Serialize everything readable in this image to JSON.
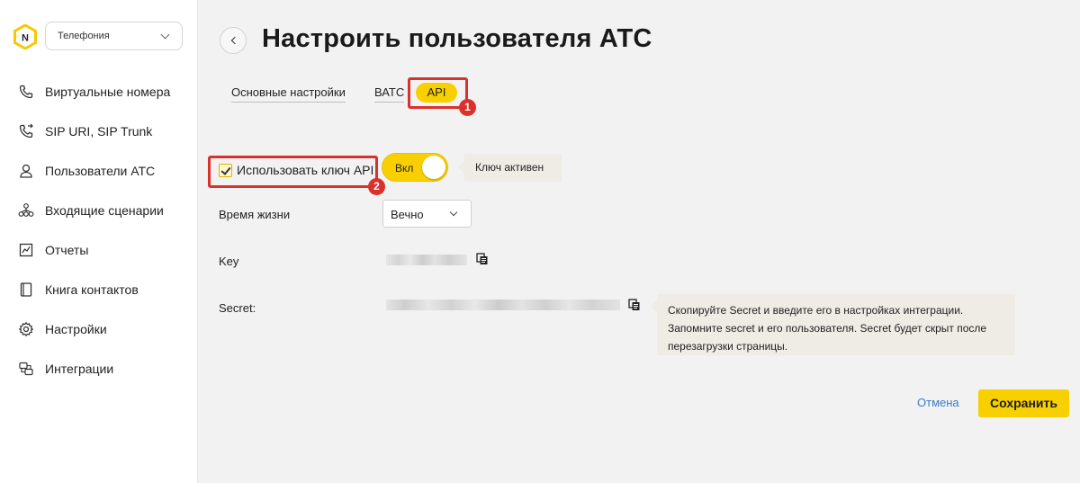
{
  "sidebar": {
    "product_select": "Телефония",
    "items": [
      {
        "label": "Виртуальные номера",
        "icon": "phone-icon"
      },
      {
        "label": "SIP URI, SIP Trunk",
        "icon": "phone-forward-icon"
      },
      {
        "label": "Пользователи АТС",
        "icon": "user-icon"
      },
      {
        "label": "Входящие сценарии",
        "icon": "scenario-icon"
      },
      {
        "label": "Отчеты",
        "icon": "chart-icon"
      },
      {
        "label": "Книга контактов",
        "icon": "book-icon"
      },
      {
        "label": "Настройки",
        "icon": "gear-icon"
      },
      {
        "label": "Интеграции",
        "icon": "integration-icon"
      }
    ]
  },
  "header": {
    "title": "Настроить пользователя АТС"
  },
  "tabs": [
    {
      "label": "Основные настройки",
      "active": false
    },
    {
      "label": "ВАТС",
      "active": false
    },
    {
      "label": "API",
      "active": true
    }
  ],
  "annotations": {
    "marker_1": "1",
    "marker_2": "2",
    "color": "#d9312b"
  },
  "api": {
    "use_key_label": "Использовать ключ API",
    "use_key_checked": true,
    "toggle_label": "Вкл",
    "toggle_on": true,
    "key_status_hint": "Ключ активен",
    "lifetime_label": "Время жизни",
    "lifetime_value": "Вечно",
    "key_label": "Key",
    "secret_label": "Secret:",
    "secret_hint": "Скопируйте Secret и введите его в настройках интеграции. Запомните secret и его пользователя. Secret будет скрыт после перезагрузки страницы."
  },
  "footer": {
    "cancel_label": "Отмена",
    "save_label": "Сохранить"
  },
  "colors": {
    "accent": "#f8d000",
    "link": "#3a7bc8",
    "background": "#f2f2f2"
  }
}
